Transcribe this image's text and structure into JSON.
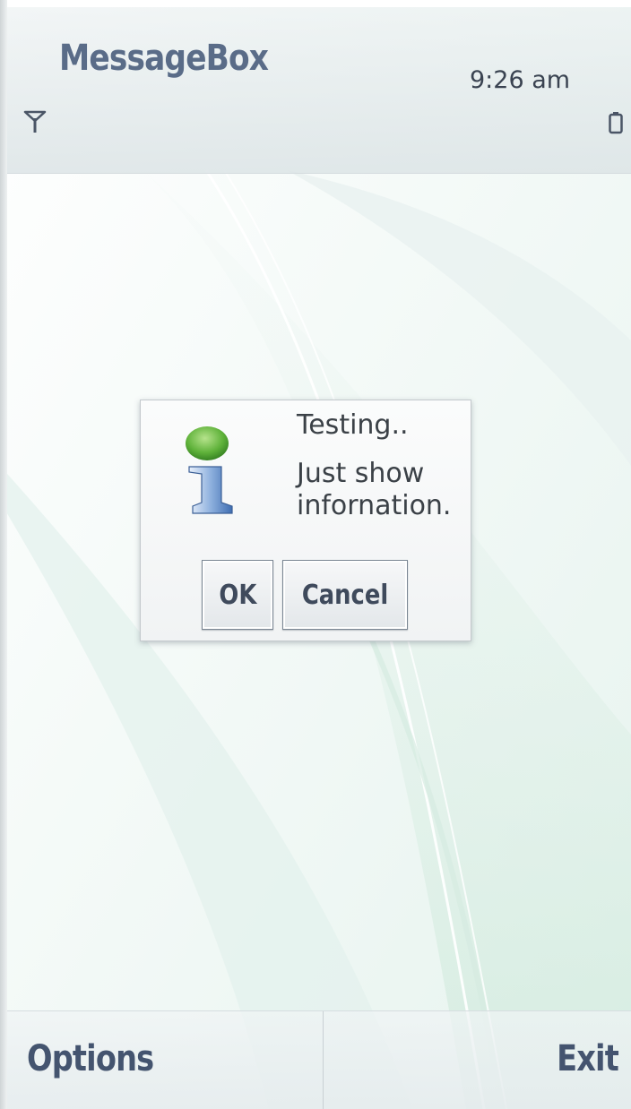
{
  "status_pane": {
    "app_title": "MessageBox",
    "clock": "9:26 am",
    "signal_icon": "signal-antenna-icon",
    "battery_icon": "battery-icon"
  },
  "dialog": {
    "icon": "information-icon",
    "heading": "Testing..",
    "message_line1": "Just show",
    "message_line2": "infornation.",
    "ok_label": "OK",
    "cancel_label": "Cancel"
  },
  "softkeys": {
    "left_label": "Options",
    "right_label": "Exit"
  },
  "colors": {
    "title_text": "#5a6c88",
    "softkey_text": "#44546f",
    "wallpaper_green": "#cfe9dc"
  }
}
